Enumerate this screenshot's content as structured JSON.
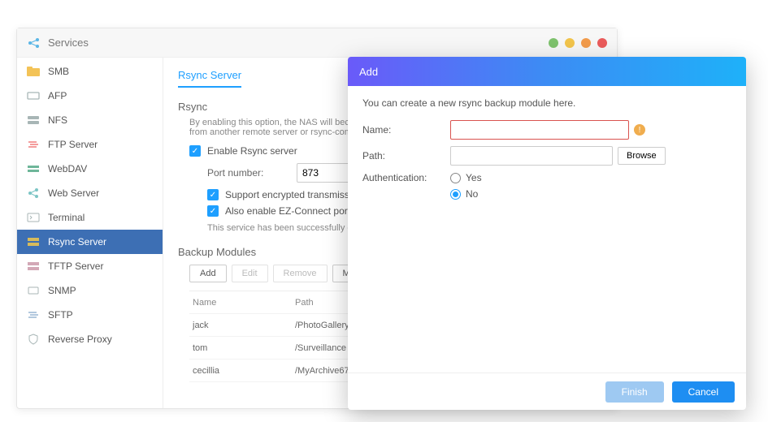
{
  "window": {
    "title": "Services"
  },
  "sidebar": {
    "items": [
      {
        "label": "SMB"
      },
      {
        "label": "AFP"
      },
      {
        "label": "NFS"
      },
      {
        "label": "FTP Server"
      },
      {
        "label": "WebDAV"
      },
      {
        "label": "Web Server"
      },
      {
        "label": "Terminal"
      },
      {
        "label": "Rsync Server"
      },
      {
        "label": "TFTP Server"
      },
      {
        "label": "SNMP"
      },
      {
        "label": "SFTP"
      },
      {
        "label": "Reverse Proxy"
      }
    ]
  },
  "main": {
    "tab": "Rsync Server",
    "section1": "Rsync",
    "desc": "By enabling this option, the NAS will become a backup server and will be able to receive backup data from another remote server or rsync-compatible servers.",
    "enable_label": "Enable Rsync server",
    "port_label": "Port number:",
    "port_value": "873",
    "ssh_label": "Support encrypted transmission via SSH",
    "ez_label": "Also enable EZ-Connect port forwarding",
    "status": "This service has been successfully enabled. You can connect to it now.",
    "section2": "Backup Modules",
    "btn_add": "Add",
    "btn_edit": "Edit",
    "btn_remove": "Remove",
    "btn_manage": "Manage Users",
    "col_name": "Name",
    "col_path": "Path",
    "rows": [
      {
        "name": "jack",
        "path": "/PhotoGallery"
      },
      {
        "name": "tom",
        "path": "/Surveillance"
      },
      {
        "name": "cecillia",
        "path": "/MyArchive67"
      }
    ]
  },
  "dialog": {
    "title": "Add",
    "intro": "You can create a new rsync backup module here.",
    "name_label": "Name:",
    "path_label": "Path:",
    "browse": "Browse",
    "auth_label": "Authentication:",
    "opt_yes": "Yes",
    "opt_no": "No",
    "finish": "Finish",
    "cancel": "Cancel"
  }
}
